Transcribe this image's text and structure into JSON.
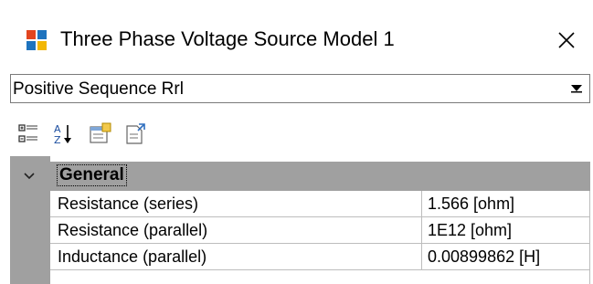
{
  "window": {
    "title": "Three Phase Voltage Source Model 1",
    "icon": "component-icon",
    "close_label": "✕"
  },
  "selector": {
    "value": "Positive Sequence Rrl",
    "arrow_icon": "dropdown-arrow-icon"
  },
  "toolbar": {
    "buttons": [
      {
        "icon": "categorized-icon"
      },
      {
        "icon": "alphabetical-sort-icon"
      },
      {
        "icon": "property-pages-icon"
      },
      {
        "icon": "export-icon"
      }
    ]
  },
  "property_grid": {
    "category": "General",
    "rows": [
      {
        "name": "Resistance (series)",
        "value": "1.566 [ohm]"
      },
      {
        "name": "Resistance (parallel)",
        "value": "1E12 [ohm]"
      },
      {
        "name": "Inductance (parallel)",
        "value": "0.00899862 [H]"
      }
    ],
    "colors": {
      "gutter": "#a0a0a0",
      "gridline": "#bdbdbd"
    }
  }
}
